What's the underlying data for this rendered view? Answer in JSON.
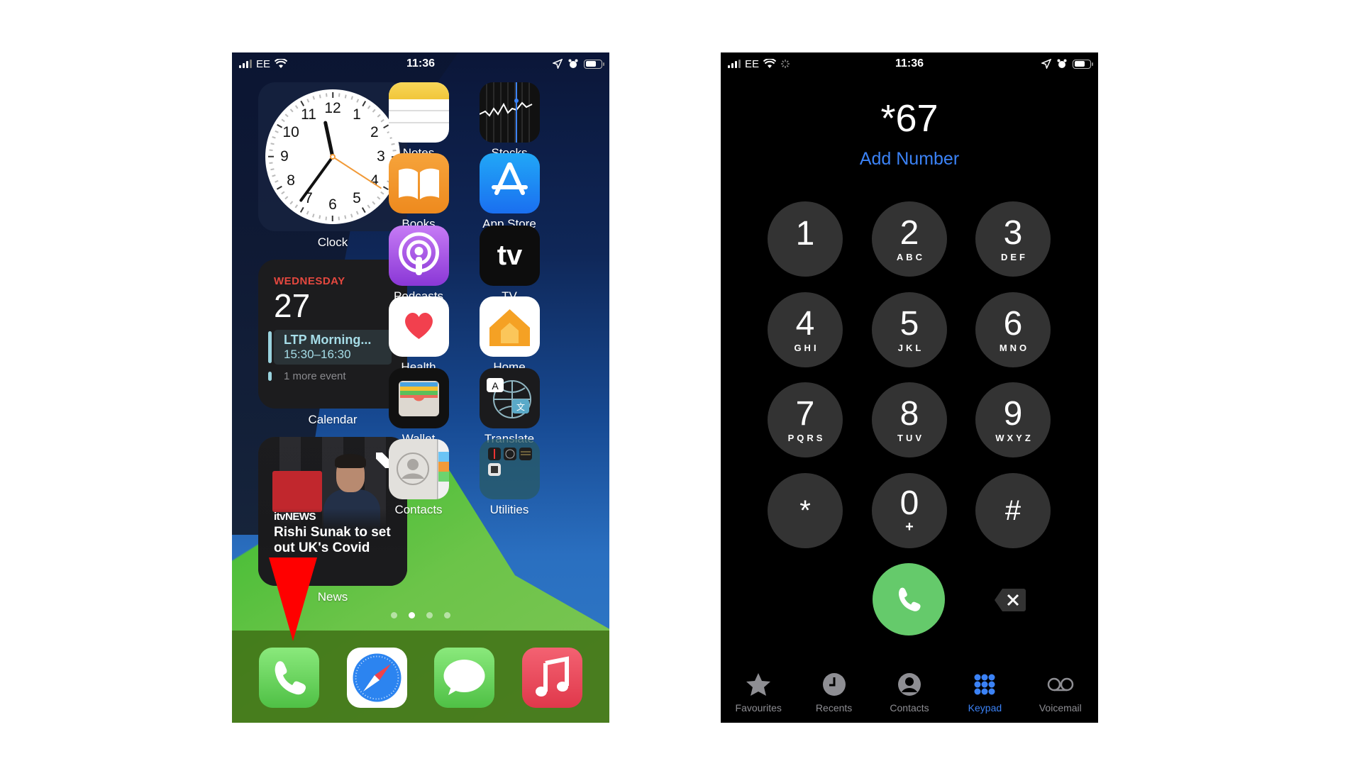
{
  "home_screen": {
    "status_bar": {
      "carrier": "EE",
      "time": "11:36"
    },
    "widgets": {
      "clock": {
        "label": "Clock",
        "numbers": [
          "12",
          "1",
          "2",
          "3",
          "4",
          "5",
          "6",
          "7",
          "8",
          "9",
          "10",
          "11"
        ],
        "time_shown": "11:36"
      },
      "calendar": {
        "label": "Calendar",
        "weekday": "WEDNESDAY",
        "date": "27",
        "event_title": "LTP Morning...",
        "event_time": "15:30–16:30",
        "more": "1 more event"
      },
      "news": {
        "label": "News",
        "source": "itvNEWS",
        "headline": "Rishi Sunak to set out UK's Covid spe..."
      }
    },
    "apps": [
      {
        "name": "Notes"
      },
      {
        "name": "Stocks"
      },
      {
        "name": "Books"
      },
      {
        "name": "App Store"
      },
      {
        "name": "Podcasts"
      },
      {
        "name": "TV"
      },
      {
        "name": "Health"
      },
      {
        "name": "Home"
      },
      {
        "name": "Wallet"
      },
      {
        "name": "Translate"
      },
      {
        "name": "Contacts"
      },
      {
        "name": "Utilities"
      }
    ],
    "tv_glyph": "tv",
    "page_dots": {
      "count": 4,
      "active": 2
    },
    "dock": [
      {
        "name": "Phone"
      },
      {
        "name": "Safari"
      },
      {
        "name": "Messages"
      },
      {
        "name": "Music"
      }
    ],
    "annotation": {
      "type": "red-arrow",
      "points_to": "Phone"
    }
  },
  "dialer_screen": {
    "status_bar": {
      "carrier": "EE",
      "time": "11:36"
    },
    "number": "*67",
    "add_number": "Add Number",
    "keys": [
      {
        "digit": "1",
        "letters": ""
      },
      {
        "digit": "2",
        "letters": "ABC"
      },
      {
        "digit": "3",
        "letters": "DEF"
      },
      {
        "digit": "4",
        "letters": "GHI"
      },
      {
        "digit": "5",
        "letters": "JKL"
      },
      {
        "digit": "6",
        "letters": "MNO"
      },
      {
        "digit": "7",
        "letters": "PQRS"
      },
      {
        "digit": "8",
        "letters": "TUV"
      },
      {
        "digit": "9",
        "letters": "WXYZ"
      },
      {
        "digit": "*",
        "letters": ""
      },
      {
        "digit": "0",
        "letters": "+"
      },
      {
        "digit": "#",
        "letters": ""
      }
    ],
    "tabs": [
      {
        "label": "Favourites",
        "icon": "star-icon",
        "active": false
      },
      {
        "label": "Recents",
        "icon": "clock-icon",
        "active": false
      },
      {
        "label": "Contacts",
        "icon": "person-circle-icon",
        "active": false
      },
      {
        "label": "Keypad",
        "icon": "keypad-icon",
        "active": true
      },
      {
        "label": "Voicemail",
        "icon": "voicemail-icon",
        "active": false
      }
    ],
    "colors": {
      "accent": "#3b82f6",
      "call": "#65ca6b",
      "key": "#333333"
    }
  }
}
